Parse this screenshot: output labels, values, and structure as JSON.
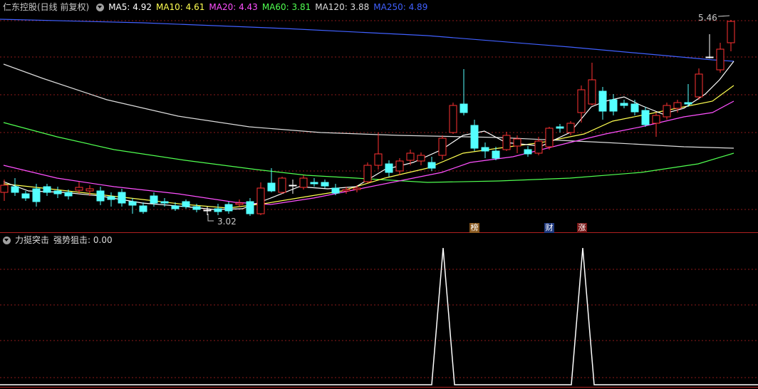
{
  "header": {
    "title": "仁东控股(日线 前复权)",
    "ma_items": [
      {
        "label": "MA5: 4.92",
        "color": "#ffffff"
      },
      {
        "label": "MA10: 4.61",
        "color": "#ffff50"
      },
      {
        "label": "MA20: 4.43",
        "color": "#ff50ff"
      },
      {
        "label": "MA60: 3.81",
        "color": "#50ff50"
      },
      {
        "label": "MA120: 3.88",
        "color": "#dcdcdc"
      },
      {
        "label": "MA250: 4.89",
        "color": "#4060ff"
      }
    ]
  },
  "main": {
    "high_label": "5.46",
    "low_label": "3.02",
    "badges": [
      {
        "text": "榜",
        "bg": "#8a5a20"
      },
      {
        "text": "财",
        "bg": "#203a80"
      },
      {
        "text": "涨",
        "bg": "#7a1818"
      }
    ]
  },
  "sub": {
    "indicator_name": "力挺突击",
    "line_label": "强势狙击: 0.00"
  },
  "colors": {
    "up": "#ff3232",
    "down": "#54ffff",
    "grid": "#8b1a1a"
  }
}
